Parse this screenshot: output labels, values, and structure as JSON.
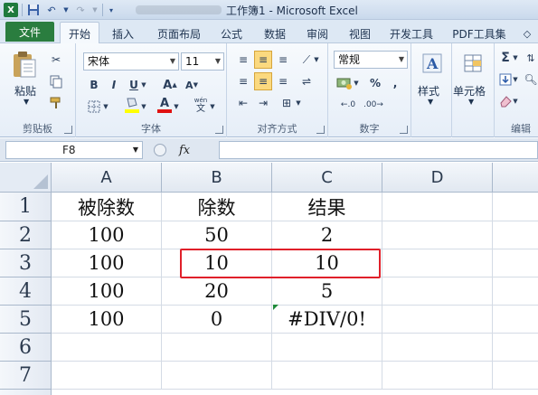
{
  "app": {
    "title": "工作簿1 - Microsoft Excel",
    "logo_letter": "X"
  },
  "quick_access": {
    "save_icon": "save-icon",
    "undo_icon": "undo-icon",
    "redo_icon": "redo-icon"
  },
  "tabs": {
    "file": "文件",
    "items": [
      "开始",
      "插入",
      "页面布局",
      "公式",
      "数据",
      "审阅",
      "视图",
      "开发工具",
      "PDF工具集"
    ],
    "active": "开始"
  },
  "ribbon": {
    "clipboard": {
      "paste": "粘贴",
      "label": "剪贴板"
    },
    "font": {
      "name": "宋体",
      "size": "11",
      "bold": "B",
      "italic": "I",
      "underline": "U",
      "font_color_letter": "A",
      "label": "字体",
      "wen": "wén"
    },
    "alignment": {
      "label": "对齐方式"
    },
    "number": {
      "format": "常规",
      "percent": "%",
      "comma": ",",
      "label": "数字"
    },
    "styles": {
      "label": "样式"
    },
    "cells": {
      "label": "单元格"
    },
    "editing": {
      "label": "编辑",
      "sigma": "Σ"
    }
  },
  "formula_bar": {
    "name_box": "F8",
    "fx": "fx",
    "value": ""
  },
  "sheet": {
    "columns": [
      "A",
      "B",
      "C",
      "D"
    ],
    "rows": [
      "1",
      "2",
      "3",
      "4",
      "5",
      "6",
      "7"
    ],
    "cells": [
      [
        "被除数",
        "除数",
        "结果",
        ""
      ],
      [
        "100",
        "50",
        "2",
        ""
      ],
      [
        "100",
        "10",
        "10",
        ""
      ],
      [
        "100",
        "20",
        "5",
        ""
      ],
      [
        "100",
        "0",
        "#DIV/0!",
        ""
      ],
      [
        "",
        "",
        "",
        ""
      ],
      [
        "",
        "",
        "",
        ""
      ]
    ],
    "highlight_color": "#e0202a"
  }
}
